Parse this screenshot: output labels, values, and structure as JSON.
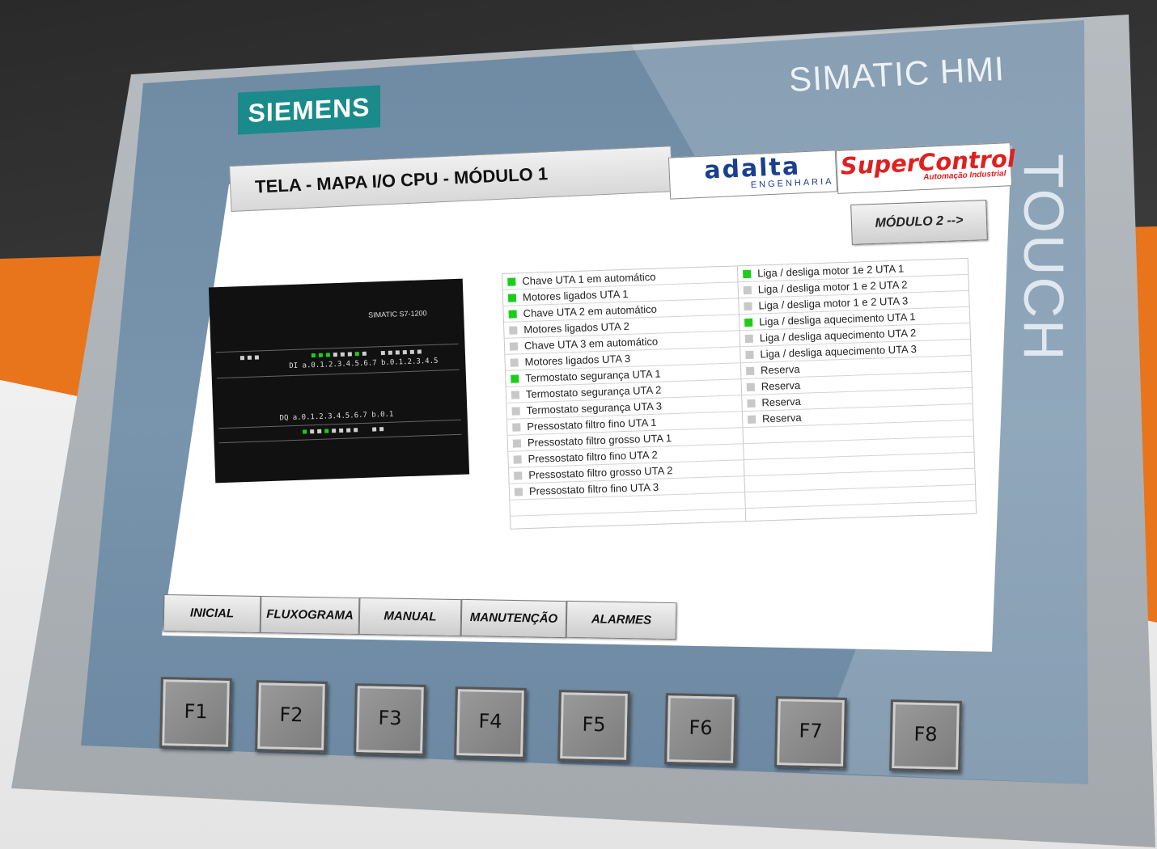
{
  "device": {
    "brand": "SIEMENS",
    "model": "SIMATIC HMI",
    "type": "TOUCH"
  },
  "screen": {
    "title": "TELA - MAPA I/O CPU - MÓDULO 1",
    "next_button": "MÓDULO 2 -->",
    "logos": {
      "adalta_name": "adalta",
      "adalta_sub": "ENGENHARIA",
      "supercontrol_name": "SuperControl",
      "supercontrol_sub": "Automação Industrial"
    },
    "plc": {
      "label": "SIMATIC S7-1200",
      "di_text": "DI a.0.1.2.3.4.5.6.7  b.0.1.2.3.4.5",
      "dq_text": "DQ a.0.1.2.3.4.5.6.7  b.0.1"
    },
    "inputs": [
      {
        "label": "Chave UTA 1 em automático",
        "on": true
      },
      {
        "label": "Motores ligados UTA 1",
        "on": true
      },
      {
        "label": "Chave UTA 2 em automático",
        "on": true
      },
      {
        "label": "Motores ligados UTA 2",
        "on": false
      },
      {
        "label": "Chave UTA 3 em automático",
        "on": false
      },
      {
        "label": "Motores ligados UTA 3",
        "on": false
      },
      {
        "label": "Termostato segurança UTA 1",
        "on": true
      },
      {
        "label": "Termostato segurança UTA 2",
        "on": false
      },
      {
        "label": "Termostato segurança UTA 3",
        "on": false
      },
      {
        "label": "Pressostato filtro fino UTA 1",
        "on": false
      },
      {
        "label": "Pressostato filtro grosso UTA 1",
        "on": false
      },
      {
        "label": "Pressostato filtro fino UTA 2",
        "on": false
      },
      {
        "label": "Pressostato filtro grosso UTA 2",
        "on": false
      },
      {
        "label": "Pressostato filtro fino UTA 3",
        "on": false
      }
    ],
    "outputs": [
      {
        "label": "Liga / desliga motor 1e 2 UTA 1",
        "on": true
      },
      {
        "label": "Liga / desliga motor 1 e 2 UTA 2",
        "on": false
      },
      {
        "label": "Liga / desliga motor 1 e 2 UTA 3",
        "on": false
      },
      {
        "label": "Liga / desliga aquecimento  UTA 1",
        "on": true
      },
      {
        "label": "Liga / desliga aquecimento  UTA 2",
        "on": false
      },
      {
        "label": "Liga / desliga aquecimento  UTA 3",
        "on": false
      },
      {
        "label": "Reserva",
        "on": false
      },
      {
        "label": "Reserva",
        "on": false
      },
      {
        "label": "Reserva",
        "on": false
      },
      {
        "label": "Reserva",
        "on": false
      }
    ],
    "nav": [
      "INICIAL",
      "FLUXOGRAMA",
      "MANUAL",
      "MANUTENÇÃO",
      "ALARMES"
    ]
  },
  "function_keys": [
    "F1",
    "F2",
    "F3",
    "F4",
    "F5",
    "F6",
    "F7",
    "F8"
  ],
  "colors": {
    "led_on": "#1ccd1c",
    "led_off": "#c8c8c8",
    "siemens_teal": "#1a8a8a",
    "panel_blue": "#7995ad",
    "background_orange": "#e8741c"
  }
}
